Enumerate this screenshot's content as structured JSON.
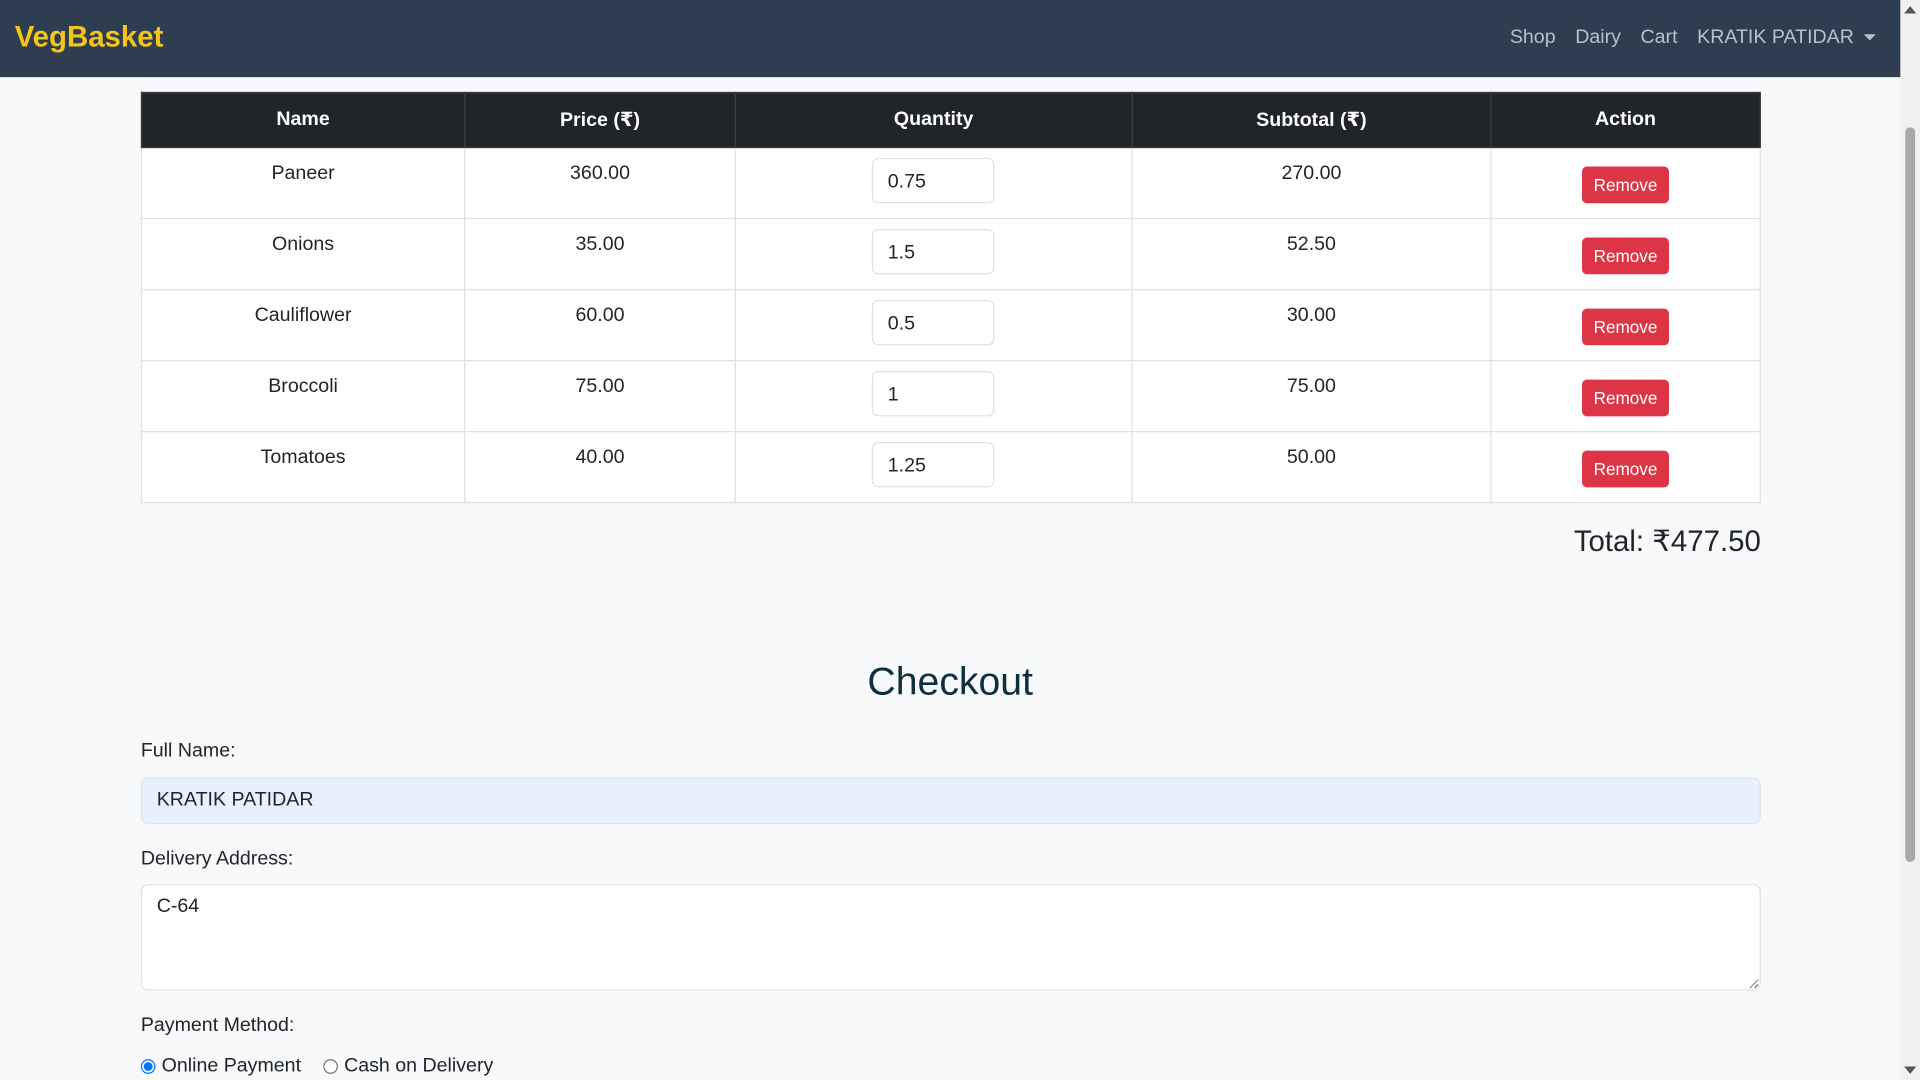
{
  "nav": {
    "brand": "VegBasket",
    "links": [
      "Shop",
      "Dairy",
      "Cart"
    ],
    "user": "KRATIK PATIDAR"
  },
  "table": {
    "headers": [
      "Name",
      "Price (₹)",
      "Quantity",
      "Subtotal (₹)",
      "Action"
    ],
    "rows": [
      {
        "name": "Paneer",
        "price": "360.00",
        "qty": "0.75",
        "subtotal": "270.00",
        "action": "Remove"
      },
      {
        "name": "Onions",
        "price": "35.00",
        "qty": "1.5",
        "subtotal": "52.50",
        "action": "Remove"
      },
      {
        "name": "Cauliflower",
        "price": "60.00",
        "qty": "0.5",
        "subtotal": "30.00",
        "action": "Remove"
      },
      {
        "name": "Broccoli",
        "price": "75.00",
        "qty": "1",
        "subtotal": "75.00",
        "action": "Remove"
      },
      {
        "name": "Tomatoes",
        "price": "40.00",
        "qty": "1.25",
        "subtotal": "50.00",
        "action": "Remove"
      }
    ]
  },
  "total": "Total: ₹477.50",
  "checkout": {
    "title": "Checkout",
    "name_label": "Full Name:",
    "name_value": "KRATIK PATIDAR",
    "address_label": "Delivery Address:",
    "address_value": "C-64",
    "payment_label": "Payment Method:",
    "options": [
      "Online Payment",
      "Cash on Delivery"
    ],
    "selected": "Online Payment"
  }
}
